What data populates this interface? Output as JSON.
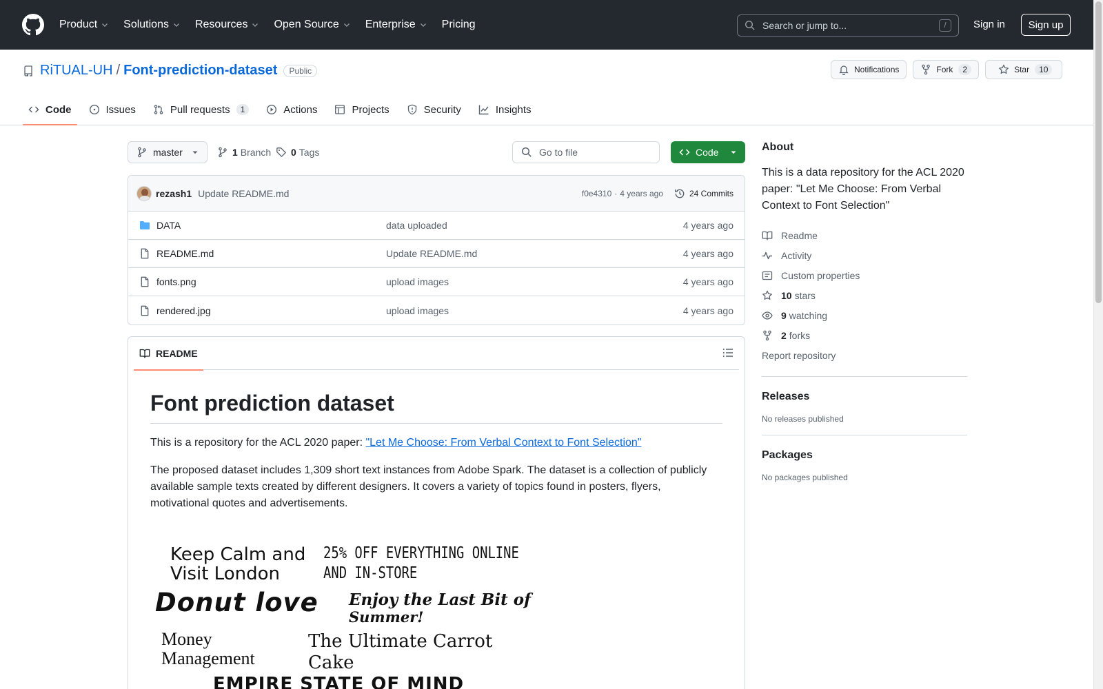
{
  "header": {
    "nav": [
      {
        "label": "Product",
        "dropdown": true
      },
      {
        "label": "Solutions",
        "dropdown": true
      },
      {
        "label": "Resources",
        "dropdown": true
      },
      {
        "label": "Open Source",
        "dropdown": true
      },
      {
        "label": "Enterprise",
        "dropdown": true
      },
      {
        "label": "Pricing",
        "dropdown": false
      }
    ],
    "search_placeholder": "Search or jump to...",
    "search_shortcut": "/",
    "signin": "Sign in",
    "signup": "Sign up"
  },
  "repo": {
    "owner": "RiTUAL-UH",
    "separator": "/",
    "name": "Font-prediction-dataset",
    "visibility": "Public",
    "notifications_label": "Notifications",
    "fork_label": "Fork",
    "fork_count": "2",
    "star_label": "Star",
    "star_count": "10",
    "tabs": [
      {
        "label": "Code",
        "icon": "code-icon",
        "active": true
      },
      {
        "label": "Issues",
        "icon": "issue-icon"
      },
      {
        "label": "Pull requests",
        "icon": "pull-request-icon",
        "count": "1"
      },
      {
        "label": "Actions",
        "icon": "play-icon"
      },
      {
        "label": "Projects",
        "icon": "table-icon"
      },
      {
        "label": "Security",
        "icon": "shield-icon"
      },
      {
        "label": "Insights",
        "icon": "graph-icon"
      }
    ]
  },
  "toolbar": {
    "branch": "master",
    "branch_count": "1",
    "branch_label": "Branch",
    "tag_count": "0",
    "tag_label": "Tags",
    "goto_placeholder": "Go to file",
    "code_button": "Code"
  },
  "commit": {
    "author": "rezash1",
    "message": "Update README.md",
    "hash": "f0e4310",
    "separator": "·",
    "time": "4 years ago",
    "count_label": "24 Commits"
  },
  "files": [
    {
      "type": "folder",
      "name": "DATA",
      "message": "data uploaded",
      "date": "4 years ago"
    },
    {
      "type": "file",
      "name": "README.md",
      "message": "Update README.md",
      "date": "4 years ago"
    },
    {
      "type": "file",
      "name": "fonts.png",
      "message": "upload images",
      "date": "4 years ago"
    },
    {
      "type": "file",
      "name": "rendered.jpg",
      "message": "upload images",
      "date": "4 years ago"
    }
  ],
  "readme": {
    "tab_label": "README",
    "title": "Font prediction dataset",
    "intro_text": "This is a repository for the ACL 2020 paper: ",
    "intro_link": "\"Let Me Choose: From Verbal Context to Font Selection\"",
    "body": "The proposed dataset includes 1,309 short text instances from Adobe Spark. The dataset is a collection of publicly available sample texts created by different designers. It covers a variety of topics found in posters, flyers, motivational quotes and advertisements.",
    "image_samples": [
      "Keep Calm and",
      "Visit London",
      "25% OFF EVERYTHING ONLINE",
      "AND IN-STORE",
      "Donut love",
      "Enjoy the Last Bit of",
      "Summer!",
      "Money",
      "Management",
      "The Ultimate Carrot",
      "Cake",
      "EMPIRE STATE OF MIND"
    ]
  },
  "sidebar": {
    "about_title": "About",
    "about_desc": "This is a data repository for the ACL 2020 paper: \"Let Me Choose: From Verbal Context to Font Selection\"",
    "readme": "Readme",
    "activity": "Activity",
    "custom_properties": "Custom properties",
    "stars_count": "10",
    "stars_label": "stars",
    "watching_count": "9",
    "watching_label": "watching",
    "forks_count": "2",
    "forks_label": "forks",
    "report": "Report repository",
    "releases_title": "Releases",
    "releases_note": "No releases published",
    "packages_title": "Packages",
    "packages_note": "No packages published"
  },
  "colors": {
    "header_bg": "#24292f",
    "link": "#0969da",
    "code_button": "#1f883d",
    "active_tab_underline": "#fd8c73",
    "folder_icon": "#54aeff"
  }
}
